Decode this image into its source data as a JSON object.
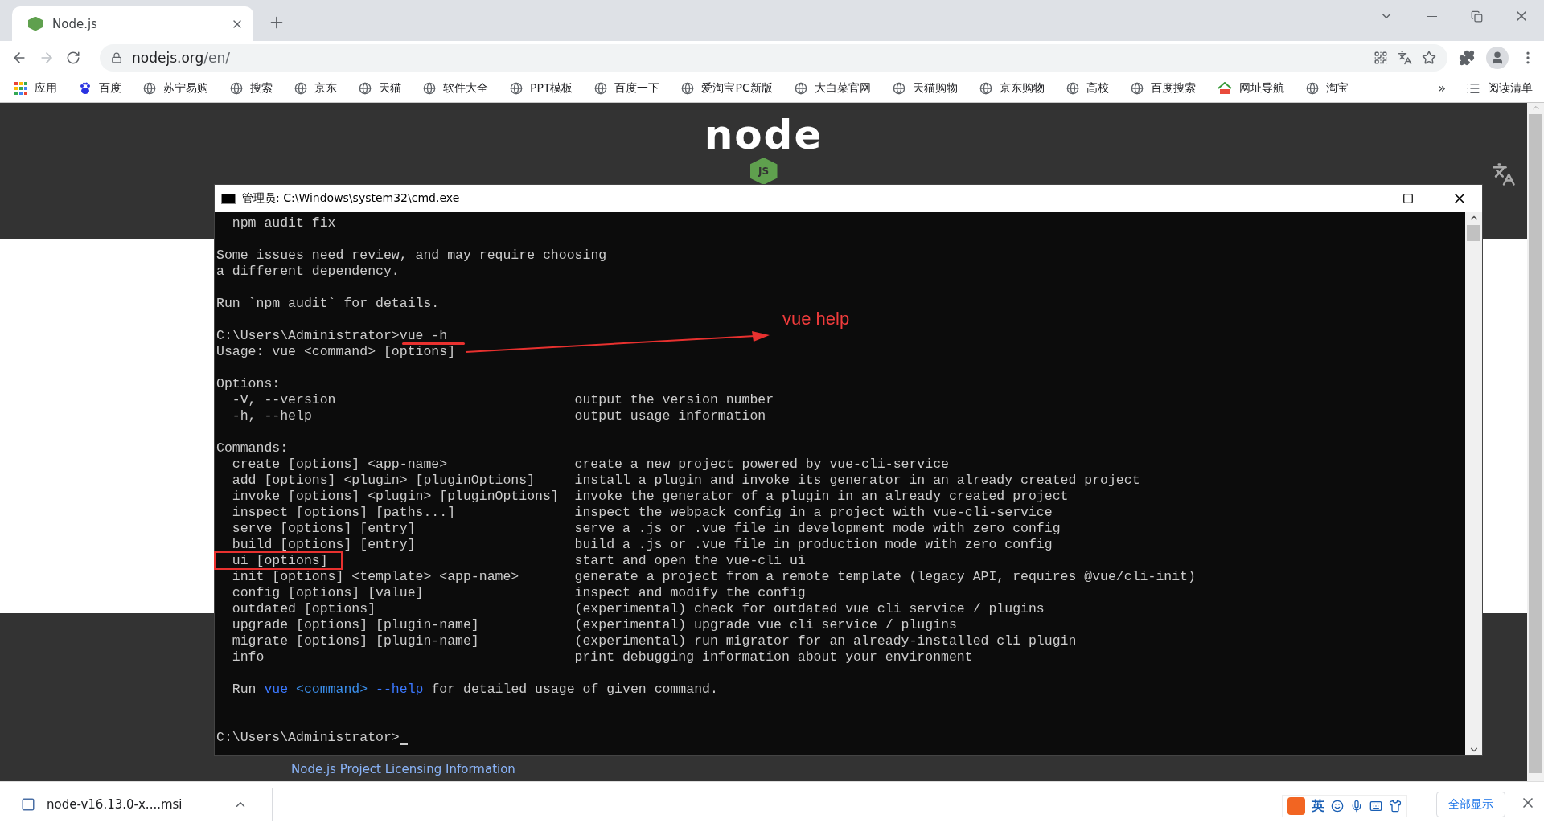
{
  "browser": {
    "tab": {
      "title": "Node.js",
      "selected": true
    },
    "address": {
      "host": "nodejs.org",
      "path": "/en/"
    },
    "bookmarks": [
      {
        "label": "应用",
        "kind": "apps"
      },
      {
        "label": "百度",
        "kind": "paw"
      },
      {
        "label": "苏宁易购",
        "kind": "globe"
      },
      {
        "label": "搜索",
        "kind": "globe"
      },
      {
        "label": "京东",
        "kind": "globe"
      },
      {
        "label": "天猫",
        "kind": "globe"
      },
      {
        "label": "软件大全",
        "kind": "globe"
      },
      {
        "label": "PPT模板",
        "kind": "globe"
      },
      {
        "label": "百度一下",
        "kind": "globe"
      },
      {
        "label": "爱淘宝PC新版",
        "kind": "globe"
      },
      {
        "label": "大白菜官网",
        "kind": "globe"
      },
      {
        "label": "天猫购物",
        "kind": "globe"
      },
      {
        "label": "京东购物",
        "kind": "globe"
      },
      {
        "label": "高校",
        "kind": "globe"
      },
      {
        "label": "百度搜索",
        "kind": "globe"
      },
      {
        "label": "网址导航",
        "kind": "house"
      },
      {
        "label": "淘宝",
        "kind": "globe"
      }
    ],
    "overflow": "»",
    "reading_list": "阅读清单"
  },
  "page": {
    "logo": {
      "word": "node",
      "badge": "JS"
    },
    "footer_link": "Node.js Project Licensing Information"
  },
  "console": {
    "title": "管理员: C:\\Windows\\system32\\cmd.exe",
    "lines": [
      {
        "kind": "text",
        "text": "  npm audit fix"
      },
      {
        "kind": "blank"
      },
      {
        "kind": "text",
        "text": "Some issues need review, and may require choosing"
      },
      {
        "kind": "text",
        "text": "a different dependency."
      },
      {
        "kind": "blank"
      },
      {
        "kind": "text",
        "text": "Run `npm audit` for details."
      },
      {
        "kind": "blank"
      },
      {
        "kind": "command",
        "prompt": "C:\\Users\\Administrator>",
        "input": "vue -h"
      },
      {
        "kind": "text",
        "text": "Usage: vue <command> [options]"
      },
      {
        "kind": "blank"
      },
      {
        "kind": "text",
        "text": "Options:"
      },
      {
        "kind": "pair",
        "left": "  -V, --version",
        "right": "output the version number"
      },
      {
        "kind": "pair",
        "left": "  -h, --help",
        "right": "output usage information"
      },
      {
        "kind": "blank"
      },
      {
        "kind": "text",
        "text": "Commands:"
      },
      {
        "kind": "pair",
        "left": "  create [options] <app-name>",
        "right": "create a new project powered by vue-cli-service"
      },
      {
        "kind": "pair",
        "left": "  add [options] <plugin> [pluginOptions]",
        "right": "install a plugin and invoke its generator in an already created project"
      },
      {
        "kind": "pair",
        "left": "  invoke [options] <plugin> [pluginOptions]",
        "right": "invoke the generator of a plugin in an already created project"
      },
      {
        "kind": "pair",
        "left": "  inspect [options] [paths...]",
        "right": "inspect the webpack config in a project with vue-cli-service"
      },
      {
        "kind": "pair",
        "left": "  serve [options] [entry]",
        "right": "serve a .js or .vue file in development mode with zero config"
      },
      {
        "kind": "pair",
        "left": "  build [options] [entry]",
        "right": "build a .js or .vue file in production mode with zero config"
      },
      {
        "kind": "pair",
        "left": "  ui [options]",
        "right": "start and open the vue-cli ui",
        "highlighted": true
      },
      {
        "kind": "pair",
        "left": "  init [options] <template> <app-name>",
        "right": "generate a project from a remote template (legacy API, requires @vue/cli-init)"
      },
      {
        "kind": "pair",
        "left": "  config [options] [value]",
        "right": "inspect and modify the config"
      },
      {
        "kind": "pair",
        "left": "  outdated [options]",
        "right": "(experimental) check for outdated vue cli service / plugins"
      },
      {
        "kind": "pair",
        "left": "  upgrade [options] [plugin-name]",
        "right": "(experimental) upgrade vue cli service / plugins"
      },
      {
        "kind": "pair",
        "left": "  migrate [options] [plugin-name]",
        "right": "(experimental) run migrator for an already-installed cli plugin"
      },
      {
        "kind": "pair",
        "left": "  info",
        "right": "print debugging information about your environment"
      },
      {
        "kind": "blank"
      },
      {
        "kind": "colored",
        "segments": [
          {
            "text": "  Run "
          },
          {
            "text": "vue ",
            "color": "#3b78ff"
          },
          {
            "text": "<command> ",
            "color": "#3b8eea"
          },
          {
            "text": "--help",
            "color": "#3b78ff"
          },
          {
            "text": " for detailed usage of given command."
          }
        ]
      },
      {
        "kind": "blank"
      },
      {
        "kind": "blank"
      },
      {
        "kind": "command",
        "prompt": "C:\\Users\\Administrator>",
        "cursor": true
      }
    ]
  },
  "annotation": {
    "label": "vue help"
  },
  "downloads": {
    "file": "node-v16.13.0-x....msi",
    "show_all": "全部显示"
  },
  "ime": {
    "language": "英"
  }
}
